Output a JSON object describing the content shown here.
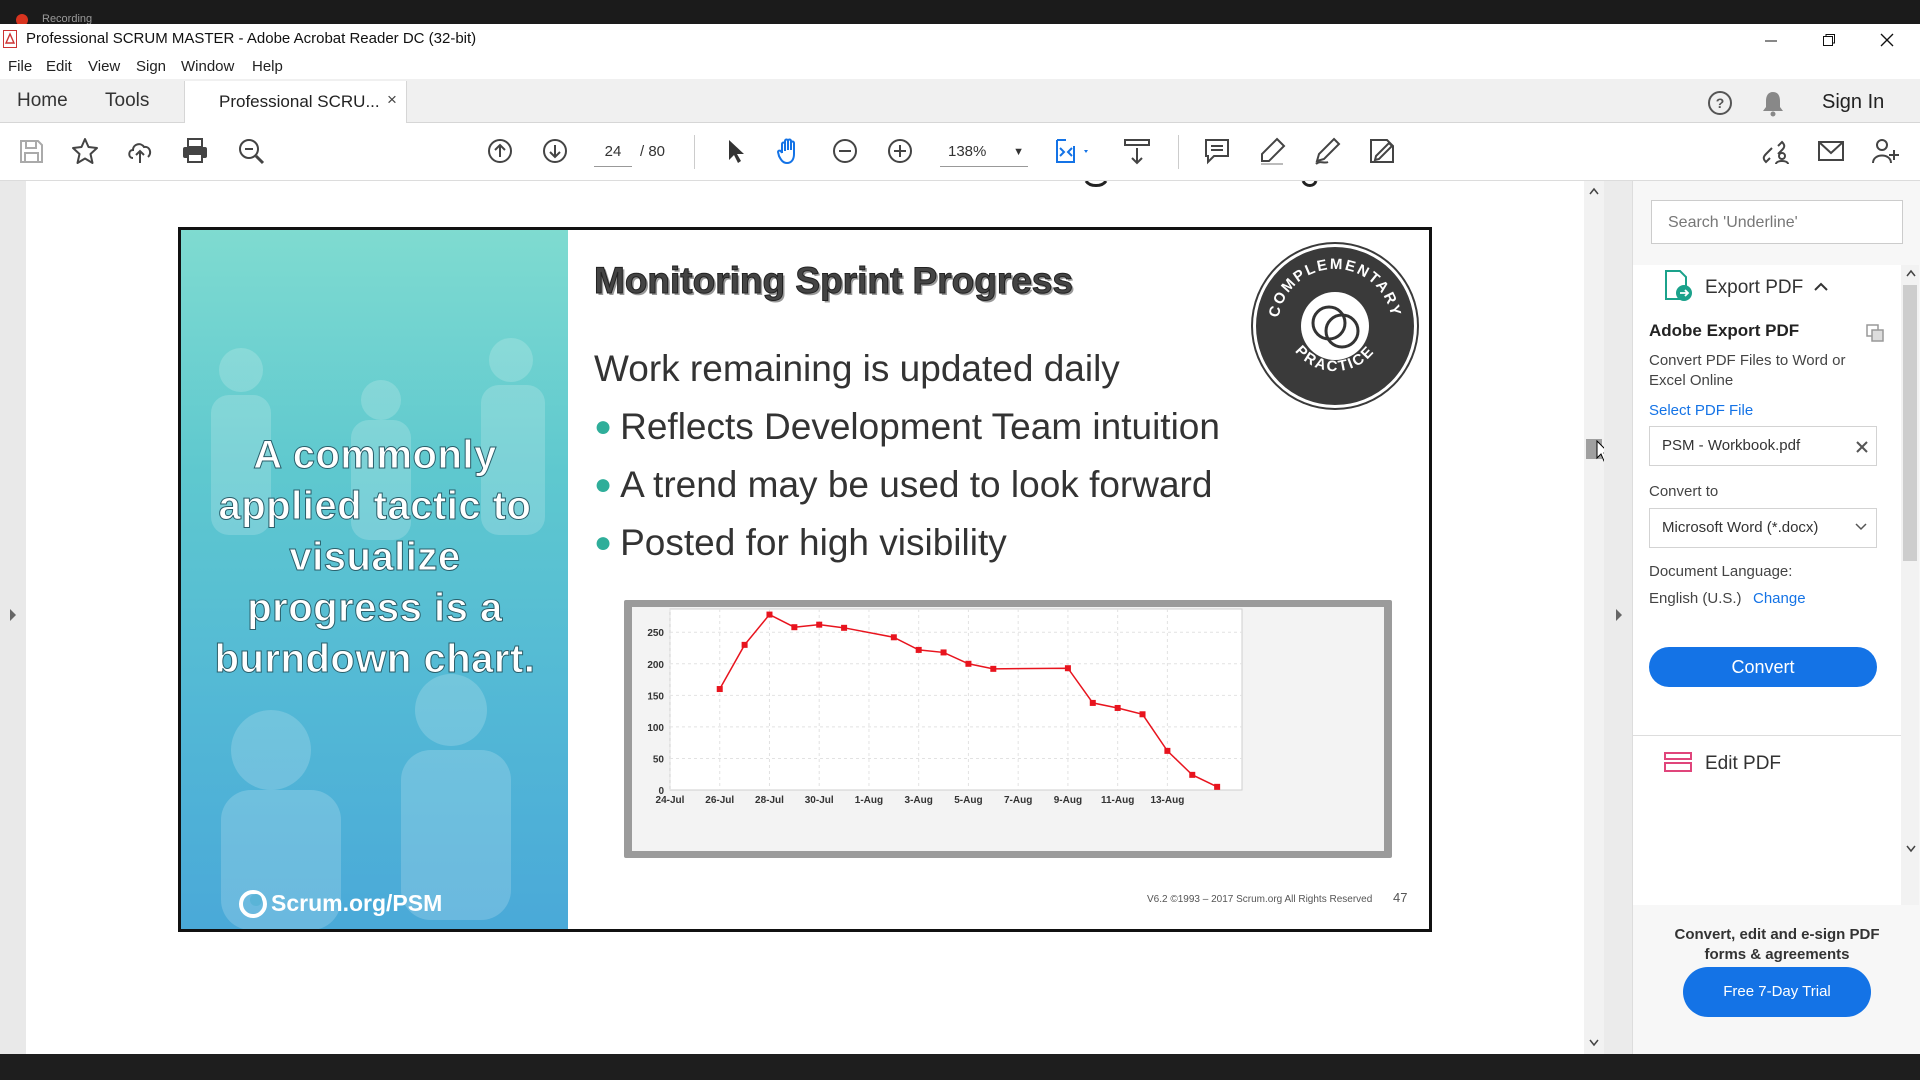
{
  "recording": {
    "label": "Recording"
  },
  "window": {
    "title": "Professional  SCRUM MASTER - Adobe Acrobat Reader DC (32-bit)"
  },
  "menu": [
    "File",
    "Edit",
    "View",
    "Sign",
    "Window",
    "Help"
  ],
  "nav": {
    "home": "Home",
    "tools": "Tools",
    "doc_tab": "Professional  SCRU...",
    "close": "×",
    "sign_in": "Sign In"
  },
  "toolbar": {
    "page_current": "24",
    "page_total": "/  80",
    "zoom": "138%"
  },
  "slide": {
    "tactic_text": "A commonly applied tactic to visualize progress is a burndown chart.",
    "brand": "Scrum.org/PSM",
    "heading": "Monitoring Sprint Progress",
    "intro": "Work remaining is updated daily",
    "bullets": [
      "Reflects Development Team intuition",
      "A trend may be used to look forward",
      "Posted for high visibility"
    ],
    "badge_top": "COMPLEMENTARY",
    "badge_bottom": "PRACTICE",
    "footer": "V6.2 ©1993 – 2017 Scrum.org All Rights Reserved",
    "page_number": "47"
  },
  "chart_data": {
    "type": "line",
    "x_ticks": [
      "24-Jul",
      "26-Jul",
      "28-Jul",
      "30-Jul",
      "1-Aug",
      "3-Aug",
      "5-Aug",
      "7-Aug",
      "9-Aug",
      "11-Aug",
      "13-Aug"
    ],
    "y_ticks": [
      0,
      50,
      100,
      150,
      200,
      250
    ],
    "ylim": [
      0,
      290
    ],
    "series": [
      {
        "color": "#e8141e",
        "x_days": [
          2,
          3,
          4,
          5,
          6,
          7,
          9,
          10,
          11,
          12,
          13,
          16,
          17,
          18,
          19,
          20,
          21,
          22
        ],
        "values": [
          160,
          230,
          278,
          258,
          262,
          257,
          242,
          222,
          218,
          200,
          192,
          193,
          138,
          130,
          120,
          62,
          24,
          5
        ],
        "x_dates": [
          "26-Jul",
          "27-Jul",
          "28-Jul",
          "29-Jul",
          "30-Jul",
          "31-Jul",
          "2-Aug",
          "3-Aug",
          "4-Aug",
          "5-Aug",
          "6-Aug",
          "9-Aug",
          "10-Aug",
          "11-Aug",
          "12-Aug",
          "13-Aug",
          "14-Aug",
          "15-Aug"
        ]
      }
    ]
  },
  "right_panel": {
    "search_placeholder": "Search 'Underline'",
    "export_title": "Export PDF",
    "adobe_export": "Adobe Export PDF",
    "export_desc": "Convert PDF Files to Word or Excel Online",
    "select_file": "Select PDF File",
    "file_name": "PSM - Workbook.pdf",
    "convert_to": "Convert to",
    "format": "Microsoft Word (*.docx)",
    "doc_lang_label": "Document Language:",
    "doc_lang": "English (U.S.)",
    "change": "Change",
    "convert_btn": "Convert",
    "edit_pdf": "Edit PDF",
    "promo": "Convert, edit and e-sign PDF forms & agreements",
    "trial_btn": "Free 7-Day Trial"
  }
}
